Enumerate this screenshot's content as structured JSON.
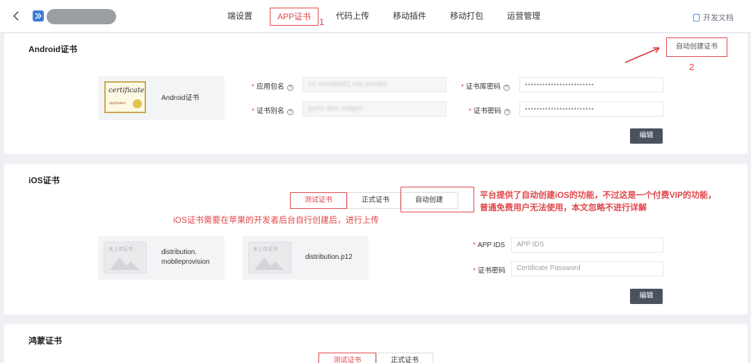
{
  "header": {
    "tabs": [
      {
        "label": "端设置"
      },
      {
        "label": "APP证书"
      },
      {
        "label": "代码上传"
      },
      {
        "label": "移动插件"
      },
      {
        "label": "移动打包"
      },
      {
        "label": "运营管理"
      }
    ],
    "annotation_1": "1",
    "docs_label": "开发文档"
  },
  "android": {
    "title": "Android证书",
    "auto_create_label": "自动创建证书",
    "annotation_2": "2",
    "cert_image_text": "certificate",
    "cert_image_sub": "application",
    "cert_label": "Android证书",
    "fields": {
      "package_label": "应用包名",
      "package_value": "cn.exmbw01.obj.yoink0",
      "alias_label": "证书别名",
      "alias_value": "yymt-dev-eidget",
      "store_pwd_label": "证书库密码",
      "store_pwd_value": "••••••••••••••••••••••••",
      "cert_pwd_label": "证书密码",
      "cert_pwd_value": "••••••••••••••••••••••••"
    },
    "edit_label": "编辑"
  },
  "ios": {
    "title": "iOS证书",
    "segments": {
      "test": "测试证书",
      "prod": "正式证书",
      "auto": "自动创建"
    },
    "note_upload": "iOS证书需要在苹果的开发者后台自行创建后，进行上传",
    "note_vip_line1": "平台提供了自动创建iOS的功能，不过这是一个付费VIP的功能，",
    "note_vip_line2": "普通免费用户无法使用，本文忽略不进行详解",
    "upload_placeholder": "未上传证书",
    "file1_line1": "distribution.",
    "file1_line2": "mobileprovision",
    "file2": "distribution.p12",
    "fields": {
      "appids_label": "APP IDS",
      "appids_placeholder": "APP IDS",
      "pwd_label": "证书密码",
      "pwd_placeholder": "Certificate Password"
    },
    "edit_label": "编辑"
  },
  "harmony": {
    "title": "鸿蒙证书",
    "segments": {
      "test": "测试证书",
      "prod": "正式证书"
    }
  },
  "colors": {
    "accent_red": "#e0474a",
    "edit_button": "#4a5260"
  },
  "icons": {
    "back": "chevron-left-icon",
    "app": "app-logo-icon",
    "docs": "document-icon",
    "help": "question-circle-icon"
  }
}
